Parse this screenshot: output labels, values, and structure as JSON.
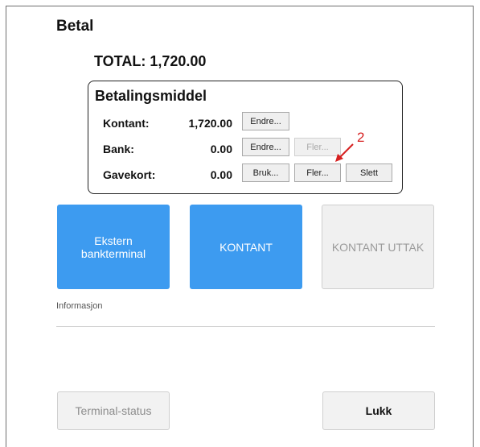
{
  "dialog": {
    "title": "Betal"
  },
  "total": {
    "text": "TOTAL: 1,720.00"
  },
  "payment_box": {
    "title": "Betalingsmiddel",
    "rows": [
      {
        "label": "Kontant:",
        "amount": "1,720.00",
        "buttons": [
          "Endre..."
        ]
      },
      {
        "label": "Bank:",
        "amount": "0.00",
        "buttons": [
          "Endre...",
          "Fler..."
        ]
      },
      {
        "label": "Gavekort:",
        "amount": "0.00",
        "buttons": [
          "Bruk...",
          "Fler...",
          "Slett"
        ]
      }
    ]
  },
  "annotation": {
    "number": "2",
    "color": "#d62020"
  },
  "actions": {
    "ekstern_line1": "Ekstern",
    "ekstern_line2": "bankterminal",
    "kontant": "KONTANT",
    "kontant_uttak": "KONTANT UTTAK"
  },
  "info_label": "Informasjon",
  "bottom": {
    "terminal_status": "Terminal-status",
    "close": "Lukk"
  },
  "colors": {
    "primary": "#3d9bf0",
    "disabled_text": "#9a9a9a"
  }
}
